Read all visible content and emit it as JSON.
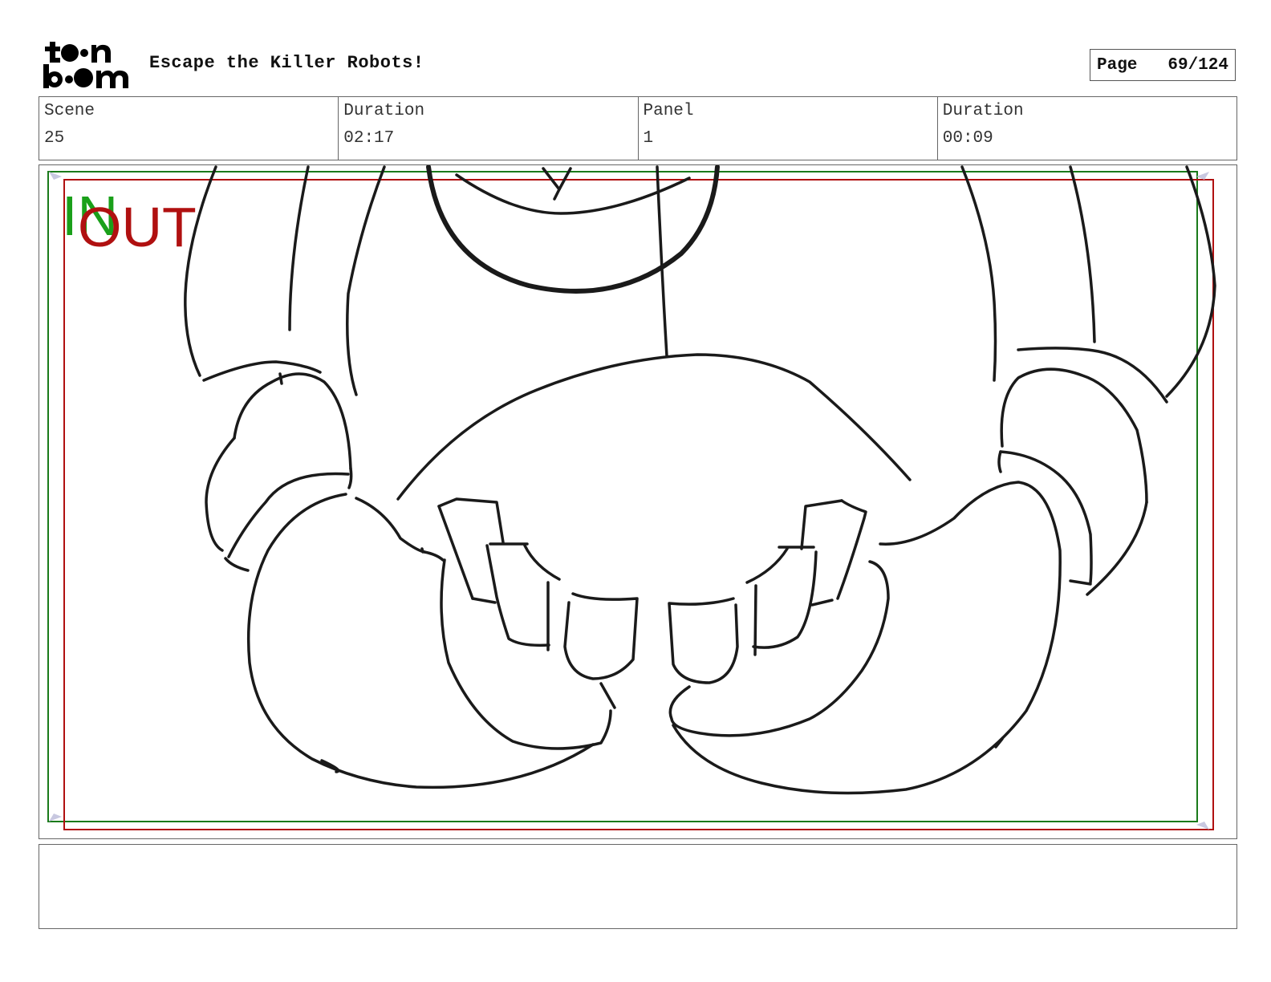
{
  "header": {
    "title": "Escape the Killer Robots!",
    "page_label": "Page",
    "page_value": "69/124"
  },
  "info": {
    "scene_label": "Scene",
    "scene_value": "25",
    "scene_duration_label": "Duration",
    "scene_duration_value": "02:17",
    "panel_label": "Panel",
    "panel_value": "1",
    "panel_duration_label": "Duration",
    "panel_duration_value": "00:09"
  },
  "panel": {
    "in_label": "IN",
    "out_label": "OUT",
    "in_color": "#1aa01a",
    "out_color": "#b01010"
  },
  "logo": {
    "icon": "toon-boom-logo"
  }
}
